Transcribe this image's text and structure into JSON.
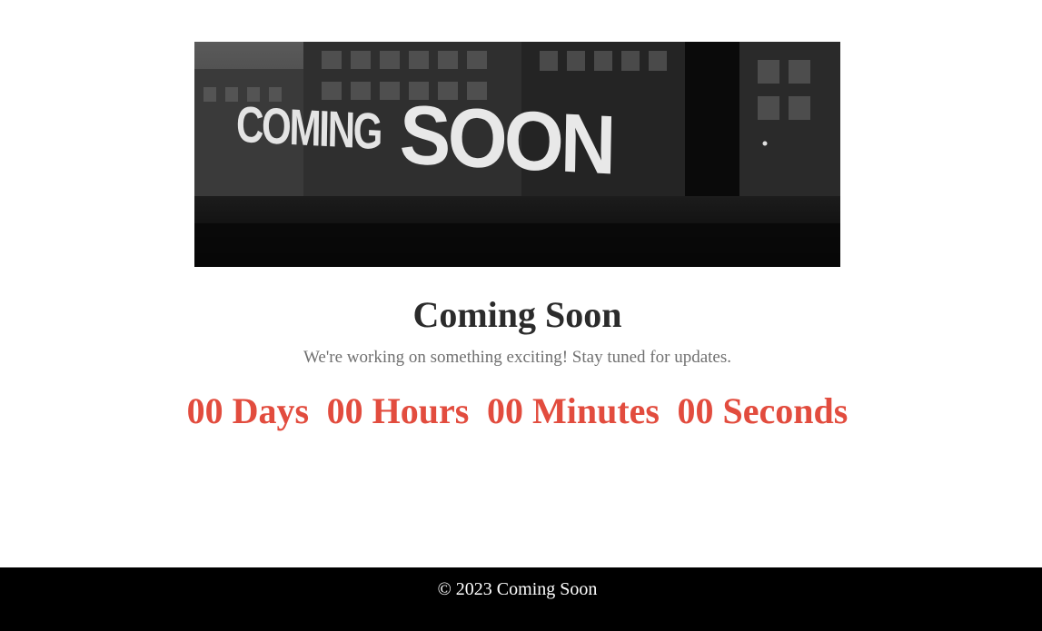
{
  "hero": {
    "image_text_small": "COMING",
    "image_text_big": "SOON"
  },
  "main": {
    "title": "Coming Soon",
    "subtitle": "We're working on something exciting! Stay tuned for updates."
  },
  "countdown": {
    "days": "00 Days",
    "hours": "00 Hours",
    "minutes": "00 Minutes",
    "seconds": "00 Seconds",
    "color": "#e24c3e"
  },
  "footer": {
    "text": "© 2023 Coming Soon"
  }
}
